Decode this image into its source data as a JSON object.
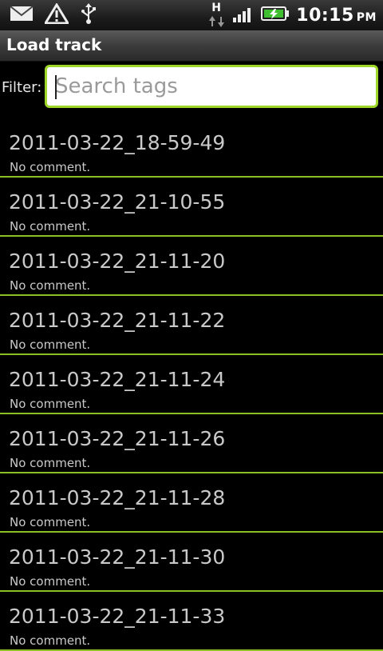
{
  "status_bar": {
    "time": "10:15",
    "ampm": "PM",
    "network_label": "H",
    "icons": [
      "email-icon",
      "warning-icon",
      "usb-icon",
      "data-arrows-icon",
      "signal-icon",
      "battery-charging-icon"
    ]
  },
  "app": {
    "title": "Load track"
  },
  "filter": {
    "label": "Filter:",
    "placeholder": "Search tags",
    "value": ""
  },
  "tracks": [
    {
      "name": "2011-03-22_18-59-49",
      "comment": "No comment."
    },
    {
      "name": "2011-03-22_21-10-55",
      "comment": "No comment."
    },
    {
      "name": "2011-03-22_21-11-20",
      "comment": "No comment."
    },
    {
      "name": "2011-03-22_21-11-22",
      "comment": "No comment."
    },
    {
      "name": "2011-03-22_21-11-24",
      "comment": "No comment."
    },
    {
      "name": "2011-03-22_21-11-26",
      "comment": "No comment."
    },
    {
      "name": "2011-03-22_21-11-28",
      "comment": "No comment."
    },
    {
      "name": "2011-03-22_21-11-30",
      "comment": "No comment."
    },
    {
      "name": "2011-03-22_21-11-33",
      "comment": "No comment."
    }
  ],
  "colors": {
    "accent": "#9fd62a",
    "divider": "#8cbf26",
    "text": "#c9c9c9",
    "background": "#000000"
  }
}
